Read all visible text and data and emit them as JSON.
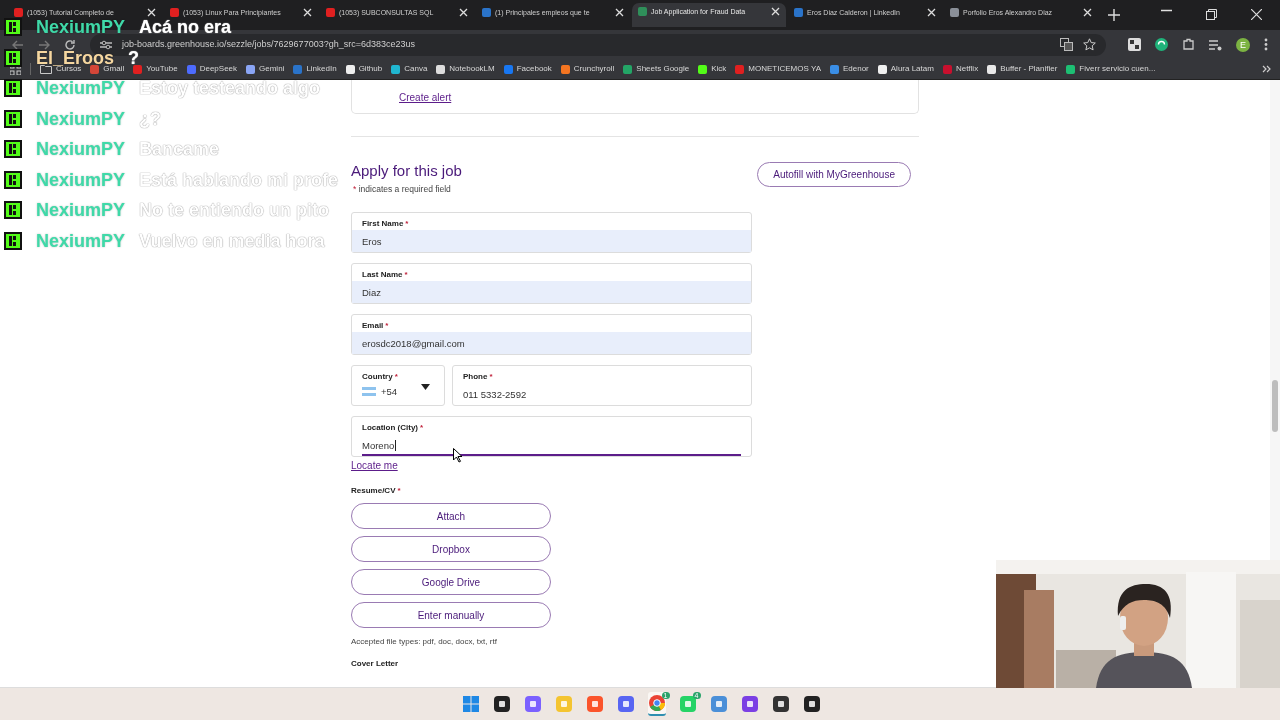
{
  "browser": {
    "tabs": [
      {
        "title": "(1053) Tutorial Completo de",
        "selected": false,
        "color": "#e02020"
      },
      {
        "title": "(1053) Linux Para Principiantes",
        "selected": false,
        "color": "#e02020"
      },
      {
        "title": "(1053) SUBCONSULTAS SQL",
        "selected": false,
        "color": "#e02020"
      },
      {
        "title": "(1) Principales empleos que te",
        "selected": false,
        "color": "#2a73c9"
      },
      {
        "title": "Job Application for Fraud Data",
        "selected": true,
        "color": "#2f8f5a"
      },
      {
        "title": "Eros Diaz Calderon | LinkedIn",
        "selected": false,
        "color": "#2a73c9"
      },
      {
        "title": "Porfolio Eros Alexandro Diaz",
        "selected": false,
        "color": "#8a8f98"
      }
    ],
    "address": "job-boards.greenhouse.io/sezzle/jobs/7629677003?gh_src=6d383ce23us",
    "profile_initial": "E",
    "bookmarks": [
      {
        "label": "Cursos",
        "kind": "folder",
        "color": "#c9c9c9"
      },
      {
        "label": "Gmail",
        "kind": "site",
        "color": "#d44638"
      },
      {
        "label": "YouTube",
        "kind": "site",
        "color": "#e02020"
      },
      {
        "label": "DeepSeek",
        "kind": "site",
        "color": "#4d6bfe"
      },
      {
        "label": "Gemini",
        "kind": "site",
        "color": "#8aa5f5"
      },
      {
        "label": "LinkedIn",
        "kind": "site",
        "color": "#2a73c9"
      },
      {
        "label": "Github",
        "kind": "site",
        "color": "#eeeeee"
      },
      {
        "label": "Canva",
        "kind": "site",
        "color": "#20b6d0"
      },
      {
        "label": "NotebookLM",
        "kind": "site",
        "color": "#dddddd"
      },
      {
        "label": "Facebook",
        "kind": "site",
        "color": "#1877f2"
      },
      {
        "label": "Crunchyroll",
        "kind": "site",
        "color": "#f47521"
      },
      {
        "label": "Sheets Google",
        "kind": "site",
        "color": "#23a566"
      },
      {
        "label": "Kick",
        "kind": "site",
        "color": "#53fc18"
      },
      {
        "label": "MONETICEMOS YA",
        "kind": "site",
        "color": "#e02020"
      },
      {
        "label": "Edenor",
        "kind": "site",
        "color": "#3a8ee6"
      },
      {
        "label": "Alura Latam",
        "kind": "site",
        "color": "#f0f0f0"
      },
      {
        "label": "Netflix",
        "kind": "site",
        "color": "#c8102e"
      },
      {
        "label": "Buffer - Planifier",
        "kind": "site",
        "color": "#e8e8e8"
      },
      {
        "label": "Fiverr servicio cuen...",
        "kind": "site",
        "color": "#1dbf73"
      }
    ]
  },
  "page": {
    "create_alert": "Create alert",
    "heading": "Apply for this job",
    "required_mark": "*",
    "required_note": "indicates a required field",
    "autofill_button": "Autofill with MyGreenhouse",
    "fields": [
      {
        "kind": "text",
        "label": "First Name",
        "required": true,
        "value": "Eros",
        "autofilled": true,
        "focused": false
      },
      {
        "kind": "text",
        "label": "Last Name",
        "required": true,
        "value": "Diaz",
        "autofilled": true,
        "focused": false
      },
      {
        "kind": "text",
        "label": "Email",
        "required": true,
        "value": "erosdc2018@gmail.com",
        "autofilled": true,
        "focused": false
      },
      {
        "kind": "country",
        "label": "Country",
        "required": true,
        "value": "+54"
      },
      {
        "kind": "text",
        "label": "Phone",
        "required": true,
        "value": "011 5332-2592",
        "autofilled": false,
        "focused": false
      },
      {
        "kind": "text",
        "label": "Location (City)",
        "required": true,
        "value": "Moreno",
        "autofilled": false,
        "focused": true
      }
    ],
    "locate_link": "Locate me",
    "resume": {
      "label": "Resume/CV",
      "required": true,
      "buttons": [
        "Attach",
        "Dropbox",
        "Google Drive",
        "Enter manually"
      ],
      "note": "Accepted file types: pdf, doc, docx, txt, rtf"
    },
    "cover_letter": {
      "label": "Cover Letter"
    }
  },
  "chat": [
    {
      "user": "NexiumPY",
      "color": "#3fd9a8",
      "message": "Acá no era"
    },
    {
      "user": "El_Eroos",
      "color": "#f6d7a0",
      "message": "?"
    },
    {
      "user": "NexiumPY",
      "color": "#3fd9a8",
      "message": "Estoy testeando algo"
    },
    {
      "user": "NexiumPY",
      "color": "#3fd9a8",
      "message": "¿?"
    },
    {
      "user": "NexiumPY",
      "color": "#3fd9a8",
      "message": "Bancame"
    },
    {
      "user": "NexiumPY",
      "color": "#3fd9a8",
      "message": "Está hablando mi profe"
    },
    {
      "user": "NexiumPY",
      "color": "#3fd9a8",
      "message": "No te entiendo un pito"
    },
    {
      "user": "NexiumPY",
      "color": "#3fd9a8",
      "message": "Vuelvo en media hora"
    }
  ],
  "taskbar": [
    {
      "kind": "windows"
    },
    {
      "kind": "app"
    },
    {
      "kind": "copilot"
    },
    {
      "kind": "folder"
    },
    {
      "kind": "brave"
    },
    {
      "kind": "discord"
    },
    {
      "kind": "chrome",
      "badge": "1",
      "selected": true
    },
    {
      "kind": "whatsapp",
      "badge": "4"
    },
    {
      "kind": "window"
    },
    {
      "kind": "arc"
    },
    {
      "kind": "obs"
    },
    {
      "kind": "capcut"
    }
  ]
}
